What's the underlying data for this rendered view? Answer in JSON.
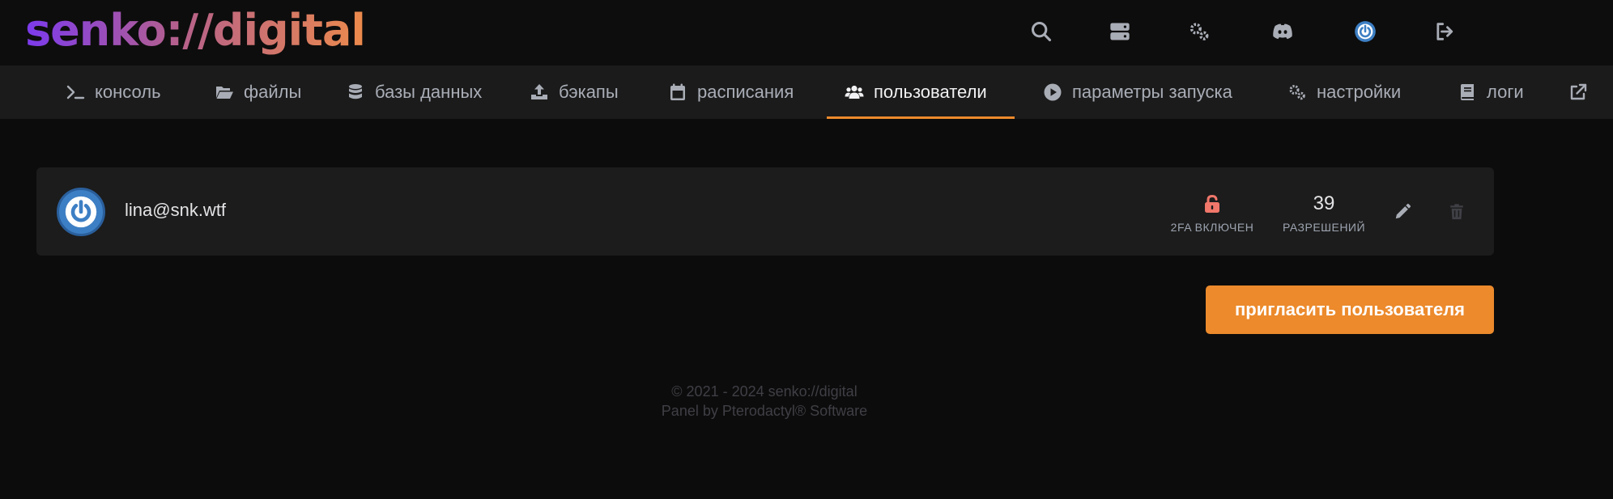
{
  "app": {
    "logo": "senko://digital"
  },
  "topbar": {
    "icons": [
      "search-icon",
      "server-icon",
      "cogs-icon",
      "discord-icon",
      "avatar-icon",
      "logout-icon"
    ]
  },
  "nav": {
    "items": [
      {
        "label": "консоль",
        "icon": "terminal-icon",
        "active": false
      },
      {
        "label": "файлы",
        "icon": "folder-open-icon",
        "active": false
      },
      {
        "label": "базы данных",
        "icon": "database-icon",
        "active": false
      },
      {
        "label": "бэкапы",
        "icon": "upload-icon",
        "active": false
      },
      {
        "label": "расписания",
        "icon": "calendar-icon",
        "active": false
      },
      {
        "label": "пользователи",
        "icon": "users-icon",
        "active": true
      },
      {
        "label": "параметры запуска",
        "icon": "play-circle-icon",
        "active": false
      },
      {
        "label": "настройки",
        "icon": "cogs-icon",
        "active": false
      },
      {
        "label": "логи",
        "icon": "book-icon",
        "active": false
      }
    ],
    "external_icon": "external-link-icon"
  },
  "users": [
    {
      "email": "lina@snk.wtf",
      "twofa_label": "2FA ВКЛЮЧЕН",
      "permissions_count": "39",
      "permissions_label": "РАЗРЕШЕНИЙ"
    }
  ],
  "actions": {
    "invite_label": "пригласить пользователя"
  },
  "footer": {
    "line1": "© 2021 - 2024 senko://digital",
    "line2": "Panel by Pterodactyl® Software"
  },
  "colors": {
    "background": "#0c0c0c",
    "nav_background": "#1b1b1b",
    "card_background": "#1c1c1c",
    "accent": "#ec8a2c",
    "lock": "#f0776a",
    "avatar": "#3d7fc4"
  }
}
